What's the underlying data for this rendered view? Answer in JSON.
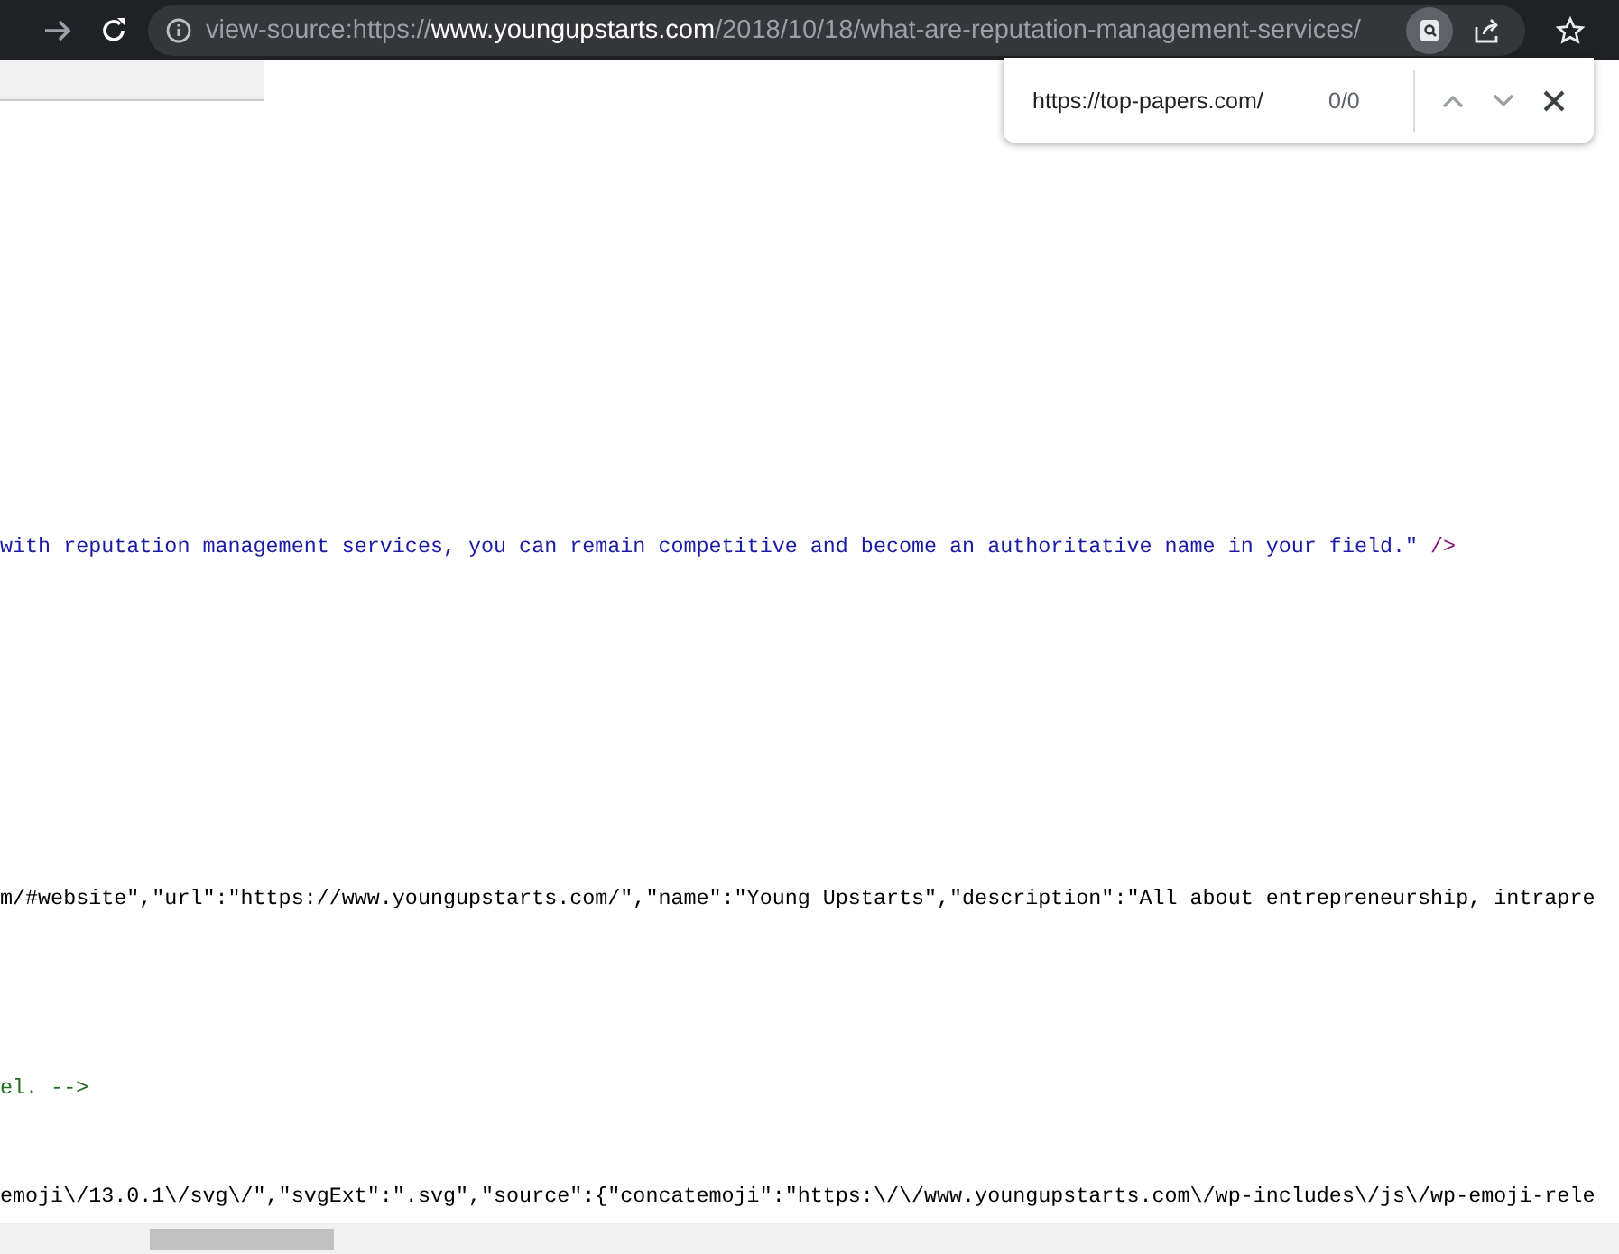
{
  "toolbar": {
    "url": {
      "scheme": "view-source:https://",
      "host": "www.youngupstarts.com",
      "path": "/2018/10/18/what-are-reputation-management-services/"
    },
    "find_in_page_active": true
  },
  "find_bar": {
    "value": "https://top-papers.com/",
    "count": "0/0"
  },
  "source_lines": [
    {
      "segments": [
        {
          "kind": "value",
          "text": "with reputation management services, you can remain competitive and become an authoritative name in your field.\""
        },
        {
          "kind": "tag",
          "text": " />"
        }
      ]
    },
    {
      "segments": [
        {
          "kind": "text",
          "text": "m/#website\",\"url\":\"https://www.youngupstarts.com/\",\"name\":\"Young Upstarts\",\"description\":\"All about entrepreneurship, intrapre"
        }
      ]
    },
    {
      "segments": [
        {
          "kind": "comment",
          "text": "el. -->"
        }
      ]
    },
    {
      "segments": [
        {
          "kind": "text",
          "text": "emoji\\/13.0.1\\/svg\\/\",\"svgExt\":\".svg\",\"source\":{\"concatemoji\":\"https:\\/\\/www.youngupstarts.com\\/wp-includes\\/js\\/wp-emoji-rele"
        }
      ]
    }
  ]
}
